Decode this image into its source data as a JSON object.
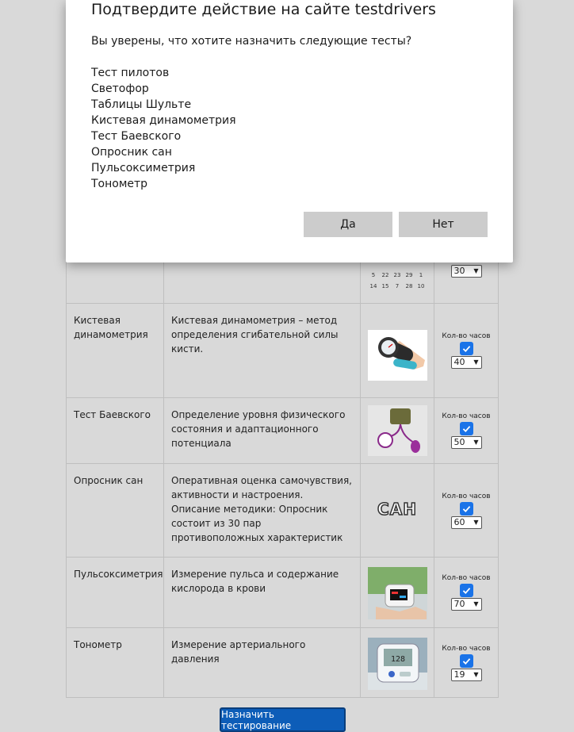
{
  "dialog": {
    "title": "Подтвердите действие на сайте testdrivers",
    "question": "Вы уверены, что хотите назначить следующие тесты?",
    "tests": [
      "Тест пилотов",
      "Светофор",
      "Таблицы Шульте",
      "Кистевая динамометрия",
      "Тест Баевского",
      "Опросник сан",
      "Пульсоксиметрия",
      "Тонометр"
    ],
    "yes_label": "Да",
    "no_label": "Нет"
  },
  "table": {
    "hours_label": "Кол-во часов",
    "rows": [
      {
        "name": "",
        "description": "",
        "hours": "30",
        "calendar": {
          "row1": [
            "5",
            "22",
            "23",
            "29",
            "1"
          ],
          "row2": [
            "14",
            "15",
            "7",
            "28",
            "10"
          ]
        }
      },
      {
        "name": "Кистевая динамометрия",
        "description": "Кистевая динамометрия – метод определения сгибательной силы кисти.",
        "hours": "40",
        "image": "hand-dynamometer-image"
      },
      {
        "name": "Тест Баевского",
        "description": "Определение уровня физического состояния и адаптационного потенциала",
        "hours": "50",
        "image": "sphygmomanometer-image"
      },
      {
        "name": "Опросник сан",
        "description": "Оперативная оценка самочувствия, активности и настроения. Описание методики: Опросник состоит из 30 пар противоположных характеристик",
        "hours": "60",
        "image_text": "САН"
      },
      {
        "name": "Пульсоксиметрия",
        "description": "Измерение пульса и содержание кислорода в крови",
        "hours": "70",
        "image": "pulse-oximeter-image"
      },
      {
        "name": "Тонометр",
        "description": "Измерение артериального давления",
        "hours": "19",
        "image": "tonometer-image"
      }
    ]
  },
  "assign_button_label": "Назначить тестирование",
  "colors": {
    "accent": "#1a73e8",
    "assign_button": "#0d5db8",
    "overlay_bg": "#d9d9d9"
  }
}
